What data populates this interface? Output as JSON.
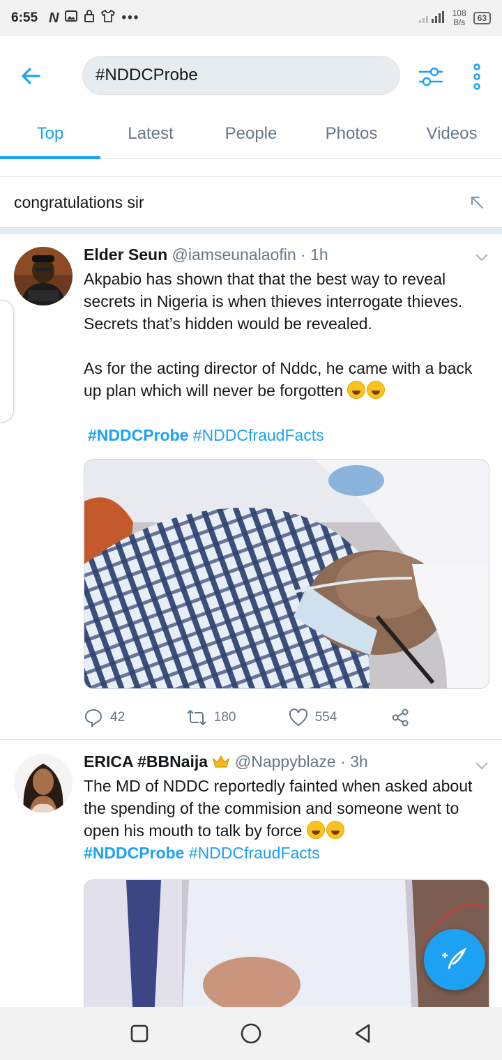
{
  "status": {
    "time": "6:55",
    "net_speed_value": "108",
    "net_speed_unit": "B/s",
    "battery": "63"
  },
  "search": {
    "query": "#NDDCProbe"
  },
  "tabs": [
    {
      "label": "Top"
    },
    {
      "label": "Latest"
    },
    {
      "label": "People"
    },
    {
      "label": "Photos"
    },
    {
      "label": "Videos"
    }
  ],
  "suggestion": {
    "text": "congratulations sir"
  },
  "tweets": [
    {
      "name": "Elder Seun",
      "handle": "@iamseunalaofin",
      "time": "· 1h",
      "text1": "Akpabio has shown that that the best way to reveal secrets in Nigeria is when thieves interrogate thieves. Secrets that’s hidden would be revealed.",
      "text2": "As for the acting director of Nddc, he came with a back up plan which will never be forgotten",
      "hashtags": [
        "#NDDCProbe",
        "#NDDCfraudFacts"
      ],
      "replies": "42",
      "retweets": "180",
      "likes": "554"
    },
    {
      "name": "ERICA #BBNaija",
      "handle": "@Nappyblaze",
      "time": "· 3h",
      "text1": "The MD of NDDC reportedly fainted when asked about the spending of the commision and someone went to open his mouth to talk by force",
      "hashtags": [
        "#NDDCProbe",
        "#NDDCfraudFacts"
      ]
    }
  ],
  "colors": {
    "accent": "#1da1f2",
    "text": "#14171a",
    "muted": "#657786"
  }
}
